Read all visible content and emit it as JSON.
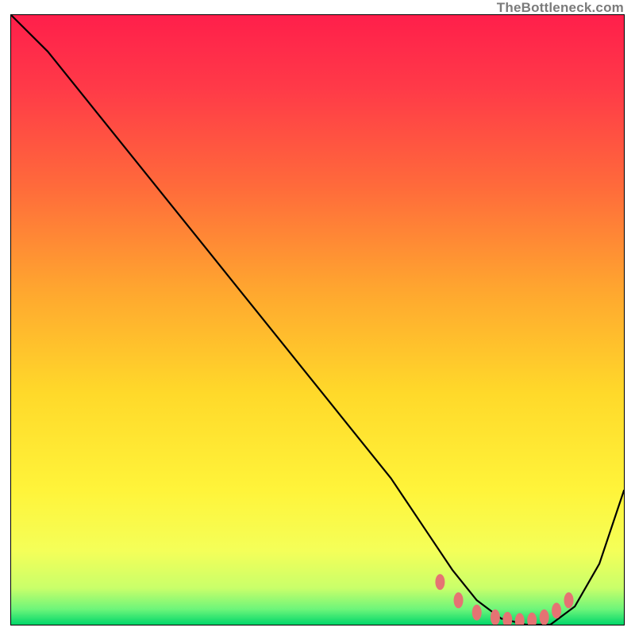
{
  "watermark": "TheBottleneck.com",
  "gradient": {
    "stops": [
      {
        "offset": 0.0,
        "color": "#ff1f4b"
      },
      {
        "offset": 0.12,
        "color": "#ff3a48"
      },
      {
        "offset": 0.28,
        "color": "#ff6a3b"
      },
      {
        "offset": 0.45,
        "color": "#ffa62f"
      },
      {
        "offset": 0.62,
        "color": "#ffd92a"
      },
      {
        "offset": 0.78,
        "color": "#fff43a"
      },
      {
        "offset": 0.88,
        "color": "#f4ff59"
      },
      {
        "offset": 0.94,
        "color": "#c9ff6a"
      },
      {
        "offset": 0.975,
        "color": "#6cf57a"
      },
      {
        "offset": 1.0,
        "color": "#00d66a"
      }
    ]
  },
  "markers": {
    "color": "#e57373",
    "rx": 6,
    "ry": 10
  },
  "chart_data": {
    "type": "line",
    "title": "",
    "xlabel": "",
    "ylabel": "",
    "xlim": [
      0,
      100
    ],
    "ylim": [
      0,
      100
    ],
    "grid": false,
    "series": [
      {
        "name": "bottleneck-curve",
        "x": [
          0,
          6,
          14,
          22,
          30,
          38,
          46,
          54,
          62,
          68,
          72,
          76,
          80,
          84,
          88,
          92,
          96,
          100
        ],
        "y": [
          100,
          94,
          84,
          74,
          64,
          54,
          44,
          34,
          24,
          15,
          9,
          4,
          1,
          0,
          0,
          3,
          10,
          22
        ]
      }
    ],
    "markers": {
      "name": "optimal-range",
      "x": [
        70,
        73,
        76,
        79,
        81,
        83,
        85,
        87,
        89,
        91
      ],
      "y": [
        7,
        4,
        2,
        1.2,
        0.8,
        0.6,
        0.7,
        1.2,
        2.3,
        4
      ]
    }
  }
}
